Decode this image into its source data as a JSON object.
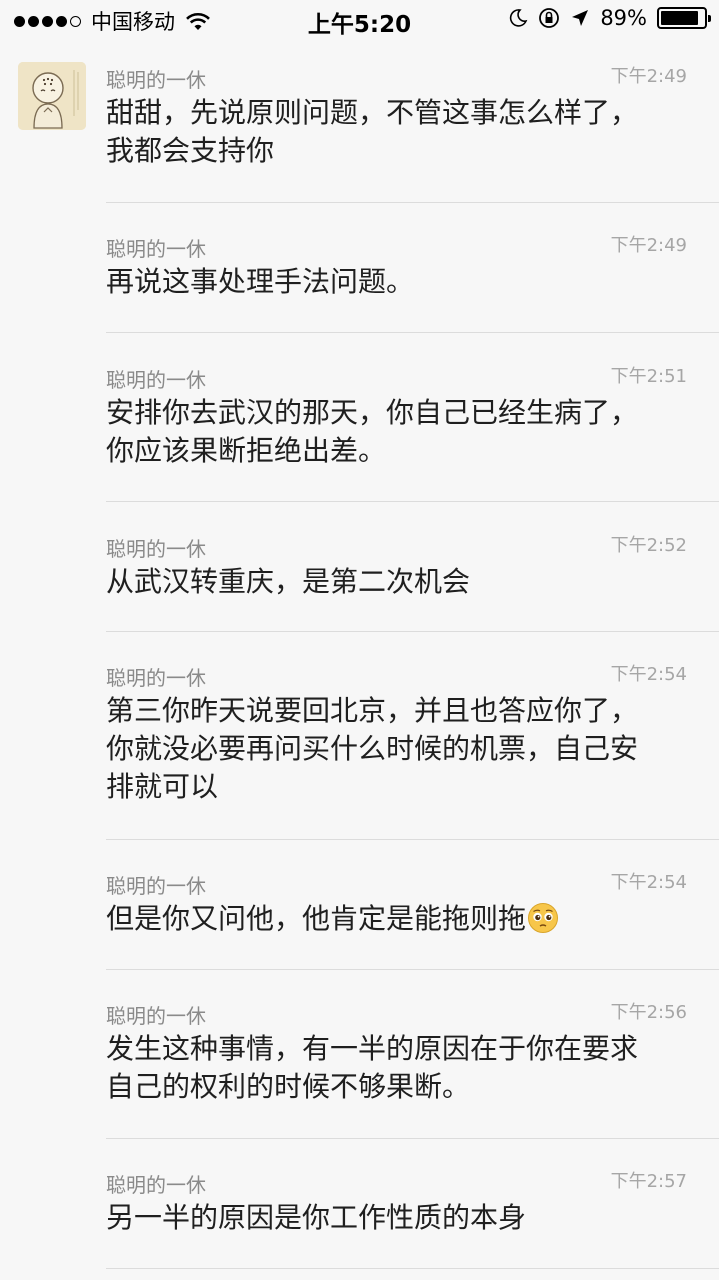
{
  "status_bar": {
    "carrier": "中国移动",
    "time": "上午5:20",
    "battery_percent": "89%",
    "battery_level": 0.89,
    "signal_bars_filled": 4,
    "signal_bars_total": 5
  },
  "messages": [
    {
      "sender": "聪明的一休",
      "time": "下午2:49",
      "text": "甜甜，先说原则问题，不管这事怎么样了，\n我都会支持你"
    },
    {
      "sender": "聪明的一休",
      "time": "下午2:49",
      "text": "再说这事处理手法问题。"
    },
    {
      "sender": "聪明的一休",
      "time": "下午2:51",
      "text": "安排你去武汉的那天，你自己已经生病了，\n你应该果断拒绝出差。"
    },
    {
      "sender": "聪明的一休",
      "time": "下午2:52",
      "text": "从武汉转重庆，是第二次机会"
    },
    {
      "sender": "聪明的一休",
      "time": "下午2:54",
      "text": "第三你昨天说要回北京，并且也答应你了，\n你就没必要再问买什么时候的机票，自己安\n排就可以"
    },
    {
      "sender": "聪明的一休",
      "time": "下午2:54",
      "text": "但是你又问他，他肯定是能拖则拖",
      "emoji": "pleading-face-emoji"
    },
    {
      "sender": "聪明的一休",
      "time": "下午2:56",
      "text": "发生这种事情，有一半的原因在于你在要求\n自己的权利的时候不够果断。"
    },
    {
      "sender": "聪明的一休",
      "time": "下午2:57",
      "text": "另一半的原因是你工作性质的本身"
    }
  ],
  "icons": {
    "avatar": "monk-avatar",
    "wifi": "wifi-icon",
    "moon": "do-not-disturb-moon-icon",
    "lock": "rotation-lock-icon",
    "location": "location-arrow-icon"
  },
  "colors": {
    "background": "#f7f7f7",
    "sender": "#8a8a8a",
    "time": "#a6a6a6",
    "divider": "#dcdcdc"
  }
}
